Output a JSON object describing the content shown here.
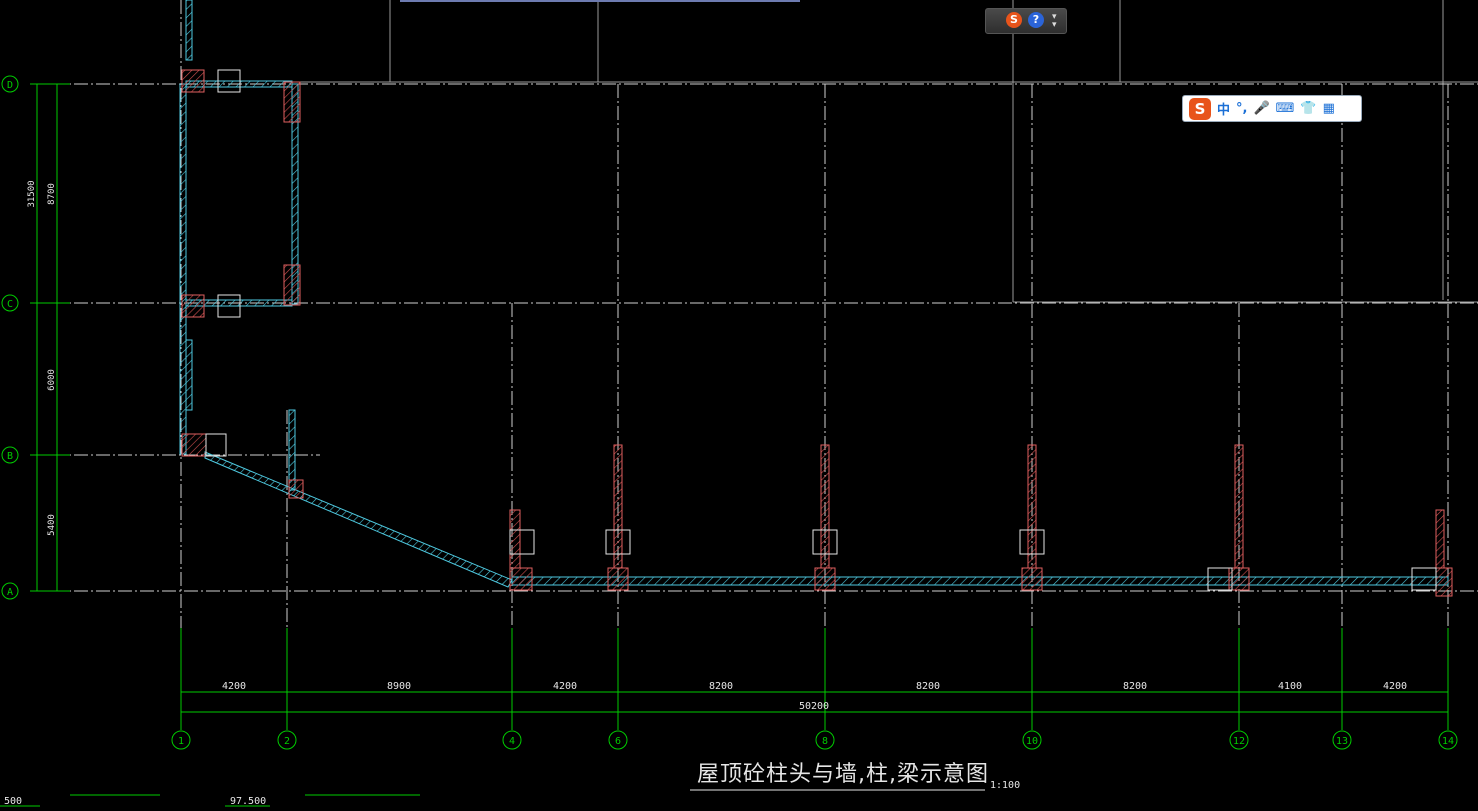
{
  "drawing": {
    "title": "屋顶砼柱头与墙,柱,梁示意图",
    "scale": "1:100",
    "dims_bottom": [
      "4200",
      "8900",
      "4200",
      "8200",
      "8200",
      "8200",
      "4100",
      "4200"
    ],
    "dim_total": "50200",
    "axis_numbers": [
      "1",
      "2",
      "4",
      "6",
      "8",
      "10",
      "12",
      "13",
      "14"
    ],
    "axis_letters": [
      "D",
      "C",
      "B",
      "A"
    ],
    "dims_left_outer": "31500",
    "dims_left": [
      "8700",
      "6000",
      "5400"
    ],
    "bottom_left_labels": [
      "500",
      "97.500"
    ]
  },
  "toolbar": {
    "s_icon": "S",
    "help_icon": "?"
  },
  "ime": {
    "logo": "S",
    "lang": "中",
    "punct": "°,",
    "icons": [
      "mic-icon",
      "keyboard-icon",
      "skin-icon",
      "grid-icon"
    ]
  },
  "colors": {
    "grid": "#00cc00",
    "wall": "#ff5a5a",
    "beam": "#4ec9e0",
    "text": "#e6e6e6",
    "background": "#000000"
  }
}
